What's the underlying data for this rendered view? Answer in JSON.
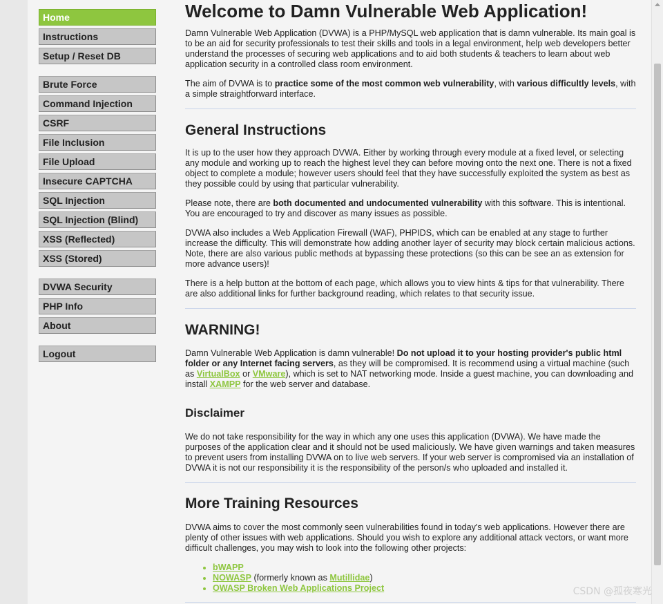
{
  "menu": {
    "groups": [
      [
        "Home",
        "Instructions",
        "Setup / Reset DB"
      ],
      [
        "Brute Force",
        "Command Injection",
        "CSRF",
        "File Inclusion",
        "File Upload",
        "Insecure CAPTCHA",
        "SQL Injection",
        "SQL Injection (Blind)",
        "XSS (Reflected)",
        "XSS (Stored)"
      ],
      [
        "DVWA Security",
        "PHP Info",
        "About"
      ],
      [
        "Logout"
      ]
    ],
    "selected": "Home"
  },
  "main": {
    "title": "Welcome to Damn Vulnerable Web Application!",
    "intro": "Damn Vulnerable Web Application (DVWA) is a PHP/MySQL web application that is damn vulnerable. Its main goal is to be an aid for security professionals to test their skills and tools in a legal environment, help web developers better understand the processes of securing web applications and to aid both students & teachers to learn about web application security in a controlled class room environment.",
    "aim": {
      "t1": "The aim of DVWA is to ",
      "b1": "practice some of the most common web vulnerability",
      "t2": ", with ",
      "b2": "various difficultly levels",
      "t3": ", with a simple straightforward interface."
    },
    "general": {
      "heading": "General Instructions",
      "p1": "It is up to the user how they approach DVWA. Either by working through every module at a fixed level, or selecting any module and working up to reach the highest level they can before moving onto the next one. There is not a fixed object to complete a module; however users should feel that they have successfully exploited the system as best as they possible could by using that particular vulnerability.",
      "p2_t1": "Please note, there are ",
      "p2_b1": "both documented and undocumented vulnerability",
      "p2_t2": " with this software. This is intentional. You are encouraged to try and discover as many issues as possible.",
      "p3": "DVWA also includes a Web Application Firewall (WAF), PHPIDS, which can be enabled at any stage to further increase the difficulty. This will demonstrate how adding another layer of security may block certain malicious actions. Note, there are also various public methods at bypassing these protections (so this can be see an as extension for more advance users)!",
      "p4": "There is a help button at the bottom of each page, which allows you to view hints & tips for that vulnerability. There are also additional links for further background reading, which relates to that security issue."
    },
    "warning": {
      "heading": "WARNING!",
      "t1": "Damn Vulnerable Web Application is damn vulnerable! ",
      "b1": "Do not upload it to your hosting provider's public html folder or any Internet facing servers",
      "t2": ", as they will be compromised. It is recommend using a virtual machine (such as ",
      "link_virtualbox": "VirtualBox",
      "t3": " or ",
      "link_vmware": "VMware",
      "t4": "), which is set to NAT networking mode. Inside a guest machine, you can downloading and install ",
      "link_xampp": "XAMPP",
      "t5": " for the web server and database."
    },
    "disclaimer": {
      "heading": "Disclaimer",
      "text": "We do not take responsibility for the way in which any one uses this application (DVWA). We have made the purposes of the application clear and it should not be used maliciously. We have given warnings and taken measures to prevent users from installing DVWA on to live web servers. If your web server is compromised via an installation of DVWA it is not our responsibility it is the responsibility of the person/s who uploaded and installed it."
    },
    "resources": {
      "heading": "More Training Resources",
      "text": "DVWA aims to cover the most commonly seen vulnerabilities found in today's web applications. However there are plenty of other issues with web applications. Should you wish to explore any additional attack vectors, or want more difficult challenges, you may wish to look into the following other projects:",
      "link_bwapp": "bWAPP",
      "link_nowasp": "NOWASP",
      "nowasp_t1": " (formerly known as ",
      "link_mutillidae": "Mutillidae",
      "nowasp_t2": ")",
      "link_owasp": "OWASP Broken Web Applications Project"
    }
  },
  "watermark": "CSDN @孤夜寒光",
  "colors": {
    "accent": "#8ec63f",
    "menu_bg": "#c6c6c6",
    "page_bg": "#f4f4f4"
  }
}
